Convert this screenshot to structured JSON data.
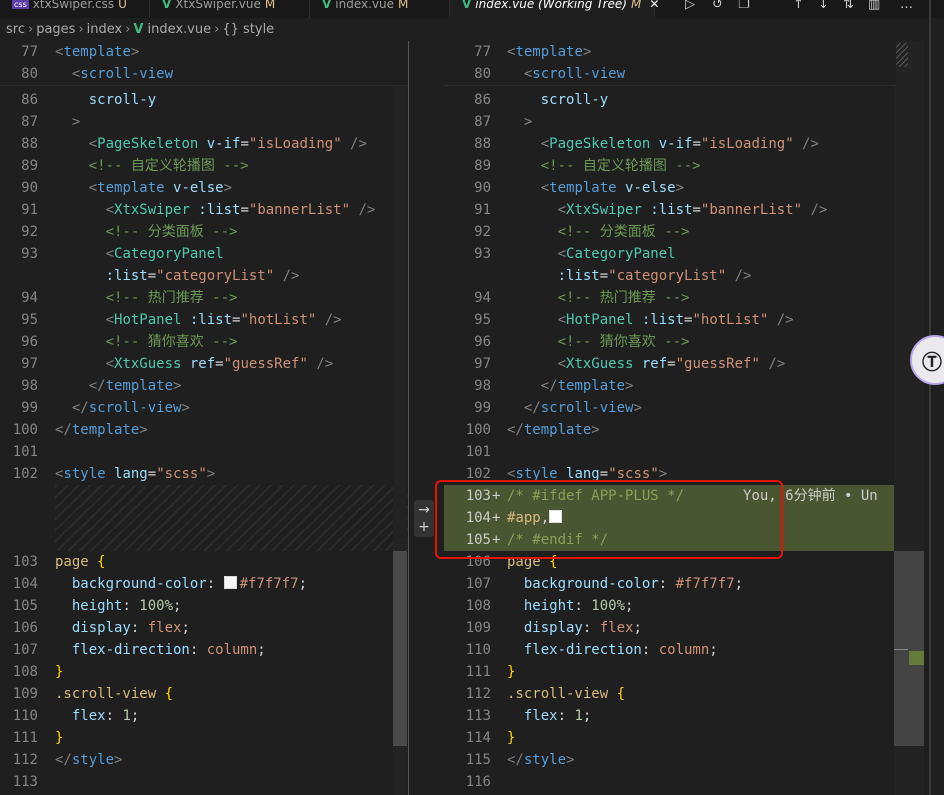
{
  "tabs": [
    {
      "label": "xtxSwiper.css",
      "status": "U",
      "icon": "css-icon"
    },
    {
      "label": "XtxSwiper.vue",
      "status": "M",
      "icon": "vue-icon"
    },
    {
      "label": "index.vue",
      "status": "M",
      "icon": "vue-icon"
    },
    {
      "label": "index.vue (Working Tree)",
      "status": "M",
      "icon": "vue-icon",
      "active": true
    }
  ],
  "breadcrumb": [
    "src",
    "pages",
    "index",
    "index.vue",
    "{} style"
  ],
  "left": {
    "sticky": [
      {
        "n": "77",
        "tokens": [
          [
            "<",
            "p"
          ],
          [
            "template",
            "tag"
          ],
          [
            ">",
            "p"
          ]
        ]
      },
      {
        "n": "80",
        "tokens": [
          [
            "  <",
            "p"
          ],
          [
            "scroll-view",
            "tag"
          ]
        ]
      }
    ],
    "lines": [
      {
        "n": "86",
        "tokens": [
          [
            "    scroll-y",
            "attr"
          ]
        ]
      },
      {
        "n": "87",
        "tokens": [
          [
            "  >",
            "p"
          ]
        ]
      },
      {
        "n": "88",
        "tokens": [
          [
            "    <",
            "p"
          ],
          [
            "PageSkeleton",
            "comp"
          ],
          [
            " v-if",
            "attr"
          ],
          [
            "=",
            "plain"
          ],
          [
            "\"isLoading\"",
            "str"
          ],
          [
            " />",
            "p"
          ]
        ]
      },
      {
        "n": "89",
        "tokens": [
          [
            "    <!-- 自定义轮播图 -->",
            "com"
          ]
        ]
      },
      {
        "n": "90",
        "tokens": [
          [
            "    <",
            "p"
          ],
          [
            "template",
            "tag"
          ],
          [
            " v-else",
            "attr"
          ],
          [
            ">",
            "p"
          ]
        ]
      },
      {
        "n": "91",
        "tokens": [
          [
            "      <",
            "p"
          ],
          [
            "XtxSwiper",
            "comp"
          ],
          [
            " :list",
            "attr"
          ],
          [
            "=",
            "plain"
          ],
          [
            "\"bannerList\"",
            "str"
          ],
          [
            " />",
            "p"
          ]
        ]
      },
      {
        "n": "92",
        "tokens": [
          [
            "      <!-- 分类面板 -->",
            "com"
          ]
        ]
      },
      {
        "n": "93",
        "tokens": [
          [
            "      <",
            "p"
          ],
          [
            "CategoryPanel",
            "comp"
          ]
        ]
      },
      {
        "n": "",
        "tokens": [
          [
            "      :list",
            "attr"
          ],
          [
            "=",
            "plain"
          ],
          [
            "\"categoryList\"",
            "str"
          ],
          [
            " />",
            "p"
          ]
        ]
      },
      {
        "n": "94",
        "tokens": [
          [
            "      <!-- 热门推荐 -->",
            "com"
          ]
        ]
      },
      {
        "n": "95",
        "tokens": [
          [
            "      <",
            "p"
          ],
          [
            "HotPanel",
            "comp"
          ],
          [
            " :list",
            "attr"
          ],
          [
            "=",
            "plain"
          ],
          [
            "\"hotList\"",
            "str"
          ],
          [
            " />",
            "p"
          ]
        ]
      },
      {
        "n": "96",
        "tokens": [
          [
            "      <!-- 猜你喜欢 -->",
            "com"
          ]
        ]
      },
      {
        "n": "97",
        "tokens": [
          [
            "      <",
            "p"
          ],
          [
            "XtxGuess",
            "comp"
          ],
          [
            " ref",
            "attr"
          ],
          [
            "=",
            "plain"
          ],
          [
            "\"guessRef\"",
            "str"
          ],
          [
            " />",
            "p"
          ]
        ]
      },
      {
        "n": "98",
        "tokens": [
          [
            "    </",
            "p"
          ],
          [
            "template",
            "tag"
          ],
          [
            ">",
            "p"
          ]
        ]
      },
      {
        "n": "99",
        "tokens": [
          [
            "  </",
            "p"
          ],
          [
            "scroll-view",
            "tag"
          ],
          [
            ">",
            "p"
          ]
        ]
      },
      {
        "n": "100",
        "tokens": [
          [
            "</",
            "p"
          ],
          [
            "template",
            "tag"
          ],
          [
            ">",
            "p"
          ]
        ]
      },
      {
        "n": "101",
        "tokens": []
      },
      {
        "n": "102",
        "tokens": [
          [
            "<",
            "p"
          ],
          [
            "style",
            "tag"
          ],
          [
            " lang",
            "attr"
          ],
          [
            "=",
            "plain"
          ],
          [
            "\"scss\"",
            "str"
          ],
          [
            ">",
            "p"
          ]
        ]
      },
      {
        "hatch": true
      },
      {
        "hatch": true
      },
      {
        "hatch": true
      },
      {
        "n": "103",
        "tokens": [
          [
            "page",
            "sel"
          ],
          [
            " {",
            "br"
          ]
        ]
      },
      {
        "n": "104",
        "tokens": [
          [
            "  background-color",
            "prop"
          ],
          [
            ": ",
            "plain"
          ],
          [
            "SW",
            "sw"
          ],
          [
            "#f7f7f7",
            "val"
          ],
          [
            ";",
            "plain"
          ]
        ]
      },
      {
        "n": "105",
        "tokens": [
          [
            "  height",
            "prop"
          ],
          [
            ": ",
            "plain"
          ],
          [
            "100%",
            "num"
          ],
          [
            ";",
            "plain"
          ]
        ]
      },
      {
        "n": "106",
        "tokens": [
          [
            "  display",
            "prop"
          ],
          [
            ": ",
            "plain"
          ],
          [
            "flex",
            "val"
          ],
          [
            ";",
            "plain"
          ]
        ]
      },
      {
        "n": "107",
        "tokens": [
          [
            "  flex-direction",
            "prop"
          ],
          [
            ": ",
            "plain"
          ],
          [
            "column",
            "val"
          ],
          [
            ";",
            "plain"
          ]
        ]
      },
      {
        "n": "108",
        "tokens": [
          [
            "}",
            "br"
          ]
        ]
      },
      {
        "n": "109",
        "tokens": [
          [
            ".scroll-view",
            "sel"
          ],
          [
            " {",
            "br"
          ]
        ]
      },
      {
        "n": "110",
        "tokens": [
          [
            "  flex",
            "prop"
          ],
          [
            ": ",
            "plain"
          ],
          [
            "1",
            "num"
          ],
          [
            ";",
            "plain"
          ]
        ]
      },
      {
        "n": "111",
        "tokens": [
          [
            "}",
            "br"
          ]
        ]
      },
      {
        "n": "112",
        "tokens": [
          [
            "</",
            "p"
          ],
          [
            "style",
            "tag"
          ],
          [
            ">",
            "p"
          ]
        ]
      },
      {
        "n": "113",
        "tokens": []
      }
    ]
  },
  "right": {
    "sticky": [
      {
        "n": "77",
        "tokens": [
          [
            "<",
            "p"
          ],
          [
            "template",
            "tag"
          ],
          [
            ">",
            "p"
          ]
        ]
      },
      {
        "n": "80",
        "tokens": [
          [
            "  <",
            "p"
          ],
          [
            "scroll-view",
            "tag"
          ]
        ]
      }
    ],
    "lines": [
      {
        "n": "86",
        "tokens": [
          [
            "    scroll-y",
            "attr"
          ]
        ]
      },
      {
        "n": "87",
        "tokens": [
          [
            "  >",
            "p"
          ]
        ]
      },
      {
        "n": "88",
        "tokens": [
          [
            "    <",
            "p"
          ],
          [
            "PageSkeleton",
            "comp"
          ],
          [
            " v-if",
            "attr"
          ],
          [
            "=",
            "plain"
          ],
          [
            "\"isLoading\"",
            "str"
          ],
          [
            " />",
            "p"
          ]
        ]
      },
      {
        "n": "89",
        "tokens": [
          [
            "    <!-- 自定义轮播图 -->",
            "com"
          ]
        ]
      },
      {
        "n": "90",
        "tokens": [
          [
            "    <",
            "p"
          ],
          [
            "template",
            "tag"
          ],
          [
            " v-else",
            "attr"
          ],
          [
            ">",
            "p"
          ]
        ]
      },
      {
        "n": "91",
        "tokens": [
          [
            "      <",
            "p"
          ],
          [
            "XtxSwiper",
            "comp"
          ],
          [
            " :list",
            "attr"
          ],
          [
            "=",
            "plain"
          ],
          [
            "\"bannerList\"",
            "str"
          ],
          [
            " />",
            "p"
          ]
        ]
      },
      {
        "n": "92",
        "tokens": [
          [
            "      <!-- 分类面板 -->",
            "com"
          ]
        ]
      },
      {
        "n": "93",
        "tokens": [
          [
            "      <",
            "p"
          ],
          [
            "CategoryPanel",
            "comp"
          ]
        ]
      },
      {
        "n": "",
        "tokens": [
          [
            "      :list",
            "attr"
          ],
          [
            "=",
            "plain"
          ],
          [
            "\"categoryList\"",
            "str"
          ],
          [
            " />",
            "p"
          ]
        ]
      },
      {
        "n": "94",
        "tokens": [
          [
            "      <!-- 热门推荐 -->",
            "com"
          ]
        ]
      },
      {
        "n": "95",
        "tokens": [
          [
            "      <",
            "p"
          ],
          [
            "HotPanel",
            "comp"
          ],
          [
            " :list",
            "attr"
          ],
          [
            "=",
            "plain"
          ],
          [
            "\"hotList\"",
            "str"
          ],
          [
            " />",
            "p"
          ]
        ]
      },
      {
        "n": "96",
        "tokens": [
          [
            "      <!-- 猜你喜欢 -->",
            "com"
          ]
        ]
      },
      {
        "n": "97",
        "tokens": [
          [
            "      <",
            "p"
          ],
          [
            "XtxGuess",
            "comp"
          ],
          [
            " ref",
            "attr"
          ],
          [
            "=",
            "plain"
          ],
          [
            "\"guessRef\"",
            "str"
          ],
          [
            " />",
            "p"
          ]
        ]
      },
      {
        "n": "98",
        "tokens": [
          [
            "    </",
            "p"
          ],
          [
            "template",
            "tag"
          ],
          [
            ">",
            "p"
          ]
        ]
      },
      {
        "n": "99",
        "tokens": [
          [
            "  </",
            "p"
          ],
          [
            "scroll-view",
            "tag"
          ],
          [
            ">",
            "p"
          ]
        ]
      },
      {
        "n": "100",
        "tokens": [
          [
            "</",
            "p"
          ],
          [
            "template",
            "tag"
          ],
          [
            ">",
            "p"
          ]
        ]
      },
      {
        "n": "101",
        "tokens": []
      },
      {
        "n": "102",
        "tokens": [
          [
            "<",
            "p"
          ],
          [
            "style",
            "tag"
          ],
          [
            " lang",
            "attr"
          ],
          [
            "=",
            "plain"
          ],
          [
            "\"scss\"",
            "str"
          ],
          [
            ">",
            "p"
          ]
        ]
      },
      {
        "n": "103",
        "added": true,
        "tokens": [
          [
            "/* #ifdef APP-PLUS */",
            "com"
          ],
          [
            "       You, 6分钟前 • Un",
            "blame"
          ]
        ]
      },
      {
        "n": "104",
        "added": true,
        "tokens": [
          [
            "#app",
            "sel"
          ],
          [
            ",",
            "plain"
          ],
          [
            "SWW",
            "sw"
          ]
        ]
      },
      {
        "n": "105",
        "added": true,
        "tokens": [
          [
            "/* #endif */",
            "com"
          ]
        ]
      },
      {
        "n": "106",
        "tokens": [
          [
            "page",
            "sel"
          ],
          [
            " {",
            "br"
          ]
        ]
      },
      {
        "n": "107",
        "tokens": [
          [
            "  background-color",
            "prop"
          ],
          [
            ": ",
            "plain"
          ],
          [
            "#f7f7f7",
            "val"
          ],
          [
            ";",
            "plain"
          ]
        ]
      },
      {
        "n": "108",
        "tokens": [
          [
            "  height",
            "prop"
          ],
          [
            ": ",
            "plain"
          ],
          [
            "100%",
            "num"
          ],
          [
            ";",
            "plain"
          ]
        ]
      },
      {
        "n": "109",
        "tokens": [
          [
            "  display",
            "prop"
          ],
          [
            ": ",
            "plain"
          ],
          [
            "flex",
            "val"
          ],
          [
            ";",
            "plain"
          ]
        ]
      },
      {
        "n": "110",
        "tokens": [
          [
            "  flex-direction",
            "prop"
          ],
          [
            ": ",
            "plain"
          ],
          [
            "column",
            "val"
          ],
          [
            ";",
            "plain"
          ]
        ]
      },
      {
        "n": "111",
        "tokens": [
          [
            "}",
            "br"
          ]
        ]
      },
      {
        "n": "112",
        "tokens": [
          [
            ".scroll-view",
            "sel"
          ],
          [
            " {",
            "br"
          ]
        ]
      },
      {
        "n": "113",
        "tokens": [
          [
            "  flex",
            "prop"
          ],
          [
            ": ",
            "plain"
          ],
          [
            "1",
            "num"
          ],
          [
            ";",
            "plain"
          ]
        ]
      },
      {
        "n": "114",
        "tokens": [
          [
            "}",
            "br"
          ]
        ]
      },
      {
        "n": "115",
        "tokens": [
          [
            "</",
            "p"
          ],
          [
            "style",
            "tag"
          ],
          [
            ">",
            "p"
          ]
        ]
      },
      {
        "n": "116",
        "tokens": []
      }
    ]
  },
  "gutter": {
    "revert_icon": "arrow-right-icon",
    "stage_icon": "plus-icon"
  },
  "avatar": {
    "label": "Ⓣ"
  },
  "colors": {
    "added_bg": "#667a3a",
    "highlight_border": "#e51400"
  }
}
